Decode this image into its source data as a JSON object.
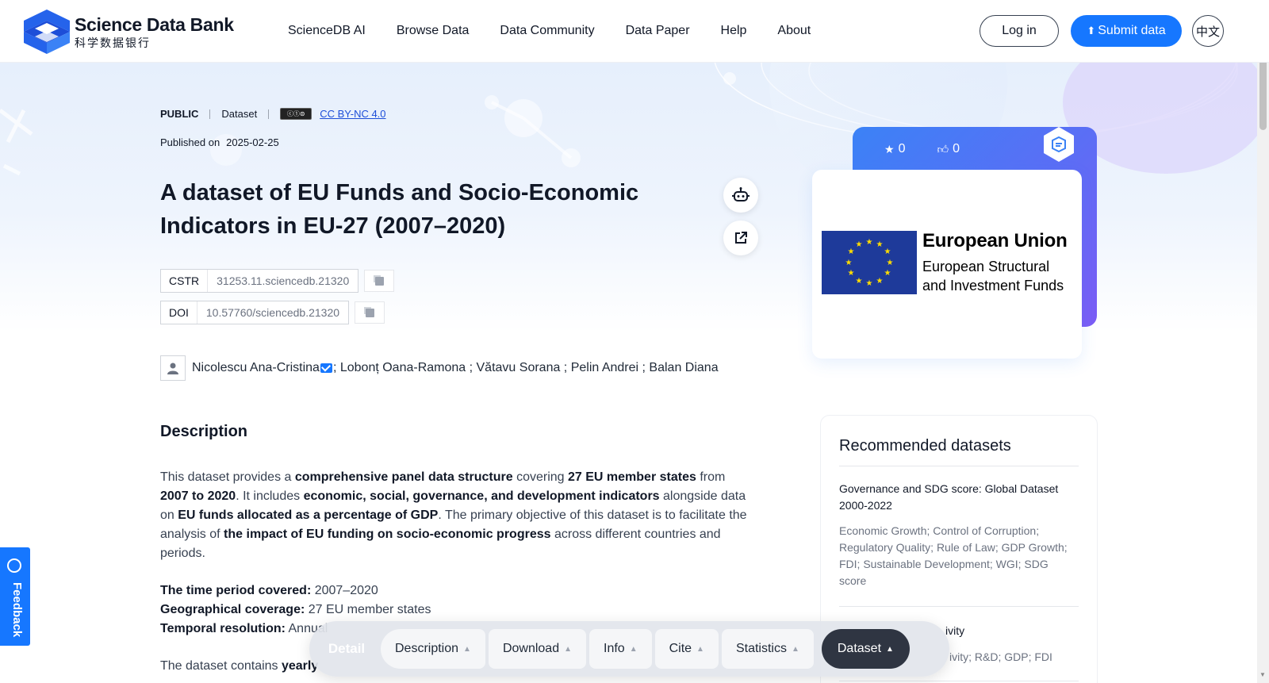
{
  "header": {
    "logo_en": "Science Data Bank",
    "logo_cn": "科学数据银行",
    "nav": [
      "ScienceDB AI",
      "Browse Data",
      "Data Community",
      "Data Paper",
      "Help",
      "About"
    ],
    "login": "Log in",
    "submit": "Submit data",
    "lang": "中文"
  },
  "meta": {
    "access": "PUBLIC",
    "type": "Dataset",
    "license": "CC BY-NC 4.0",
    "published_label": "Published on",
    "published_date": "2025-02-25"
  },
  "title": "A dataset of EU Funds and Socio-Economic Indicators in EU-27 (2007–2020)",
  "identifiers": {
    "cstr_label": "CSTR",
    "cstr": "31253.11.sciencedb.21320",
    "doi_label": "DOI",
    "doi": "10.57760/sciencedb.21320"
  },
  "authors": {
    "first": "Nicolescu Ana-Cristina",
    "rest": "; Lobonț Oana-Ramona ; Vătavu Sorana ; Pelin Andrei ; Balan Diana"
  },
  "description": {
    "heading": "Description",
    "p1": [
      {
        "t": "This dataset provides a ",
        "b": false
      },
      {
        "t": "comprehensive panel data structure",
        "b": true
      },
      {
        "t": " covering ",
        "b": false
      },
      {
        "t": "27 EU member states",
        "b": true
      },
      {
        "t": " from ",
        "b": false
      },
      {
        "t": "2007 to 2020",
        "b": true
      },
      {
        "t": ". It includes ",
        "b": false
      },
      {
        "t": "economic, social, governance, and development indicators",
        "b": true
      },
      {
        "t": " alongside data on ",
        "b": false
      },
      {
        "t": "EU funds allocated as a percentage of GDP",
        "b": true
      },
      {
        "t": ". The primary objective of this dataset is to facilitate the analysis of ",
        "b": false
      },
      {
        "t": "the impact of EU funding on socio-economic progress",
        "b": true
      },
      {
        "t": " across different countries and periods.",
        "b": false
      }
    ],
    "time_label": "The time period covered:",
    "time_value": " 2007–2020",
    "geo_label": "Geographical coverage:",
    "geo_value": " 27 EU member states",
    "temporal_label": "Temporal resolution:",
    "temporal_value": " Annual",
    "p3_start": "The dataset contains ",
    "p3_bold": "yearly"
  },
  "cover": {
    "stars": "0",
    "likes": "0",
    "eu_title": "European Union",
    "eu_line1": "European Structural",
    "eu_line2": "and Investment Funds"
  },
  "recommended": {
    "heading": "Recommended datasets",
    "items": [
      {
        "title": "Governance and SDG score: Global Dataset 2000-2022",
        "keywords": "Economic Growth; Control of Corruption; Regulatory Quality; Rule of Law; GDP Growth; FDI; Sustainable Development; WGI; SDG score"
      },
      {
        "title": "ivity",
        "keywords": "ivity; R&D; GDP; FDI"
      }
    ]
  },
  "feedback": "Feedback",
  "bottom_bar": {
    "detail": "Detail",
    "tabs": [
      "Description",
      "Download",
      "Info",
      "Cite",
      "Statistics"
    ],
    "dataset": "Dataset"
  }
}
